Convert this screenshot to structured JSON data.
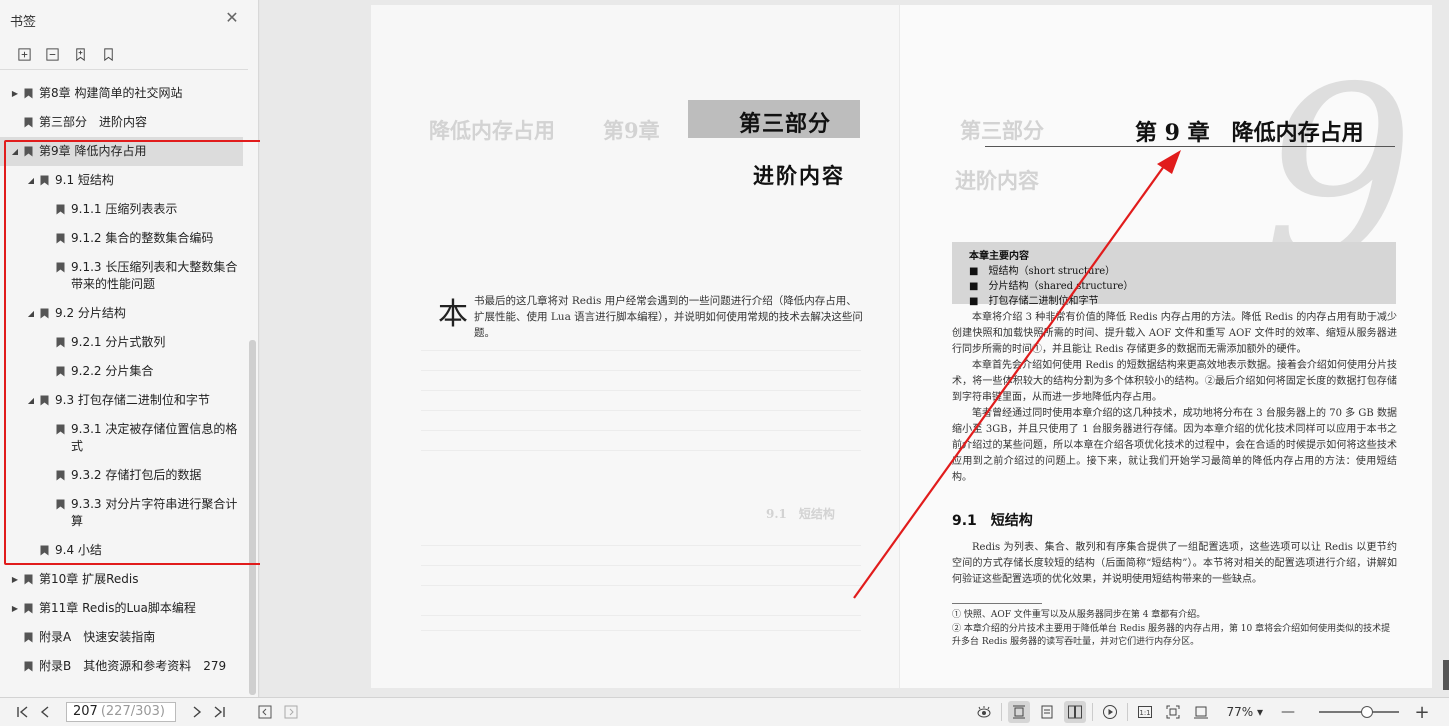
{
  "sidebar": {
    "title": "书签",
    "tools": [
      {
        "name": "expand-all-icon"
      },
      {
        "name": "collapse-all-icon"
      },
      {
        "name": "add-bookmark-icon"
      },
      {
        "name": "bookmark-icon"
      }
    ],
    "items": [
      {
        "label": "第8章 构建简单的社交网站",
        "level": 0,
        "arrow": "▶"
      },
      {
        "label": "第三部分　进阶内容",
        "level": 0,
        "arrow": ""
      },
      {
        "label": "第9章 降低内存占用",
        "level": 0,
        "arrow": "◢",
        "selected": true
      },
      {
        "label": "9.1 短结构",
        "level": 1,
        "arrow": "◢"
      },
      {
        "label": "9.1.1 压缩列表表示",
        "level": 2,
        "arrow": ""
      },
      {
        "label": "9.1.2 集合的整数集合编码",
        "level": 2,
        "arrow": ""
      },
      {
        "label": "9.1.3 长压缩列表和大整数集合带来的性能问题",
        "level": 2,
        "arrow": ""
      },
      {
        "label": "9.2 分片结构",
        "level": 1,
        "arrow": "◢"
      },
      {
        "label": "9.2.1 分片式散列",
        "level": 2,
        "arrow": ""
      },
      {
        "label": "9.2.2 分片集合",
        "level": 2,
        "arrow": ""
      },
      {
        "label": "9.3 打包存储二进制位和字节",
        "level": 1,
        "arrow": "◢"
      },
      {
        "label": "9.3.1 决定被存储位置信息的格式",
        "level": 2,
        "arrow": ""
      },
      {
        "label": "9.3.2 存储打包后的数据",
        "level": 2,
        "arrow": ""
      },
      {
        "label": "9.3.3 对分片字符串进行聚合计算",
        "level": 2,
        "arrow": ""
      },
      {
        "label": "9.4 小结",
        "level": 1,
        "arrow": ""
      },
      {
        "label": "第10章 扩展Redis",
        "level": 0,
        "arrow": "▶"
      },
      {
        "label": "第11章 Redis的Lua脚本编程",
        "level": 0,
        "arrow": "▶"
      },
      {
        "label": "附录A　快速安装指南",
        "level": 0,
        "arrow": ""
      },
      {
        "label": "附录B　其他资源和参考资料　279",
        "level": 0,
        "arrow": ""
      }
    ]
  },
  "left_page": {
    "part": "第三部分",
    "subtitle": "进阶内容",
    "ghost_left": "降低内存占用",
    "ghost_right": "第9章",
    "dropcap": "本",
    "intro": "书最后的这几章将对 Redis 用户经常会遇到的一些问题进行介绍（降低内存占用、扩展性能、使用 Lua 语言进行脚本编程），并说明如何使用常规的技术去解决这些问题。",
    "ghost_section": "9.1　短结构"
  },
  "right_page": {
    "chapter_title": "第 9 章　降低内存占用",
    "big_number": "9",
    "ghost_part": "第三部分",
    "ghost_sub": "进阶内容",
    "box_head": "本章主要内容",
    "box_items": [
      "■　短结构（short structure）",
      "■　分片结构（shared structure）",
      "■　打包存储二进制位和字节"
    ],
    "paragraphs": [
      "本章将介绍 3 种非常有价值的降低 Redis 内存占用的方法。降低 Redis 的内存占用有助于减少创建快照和加载快照所需的时间、提升载入 AOF 文件和重写 AOF 文件时的效率、缩短从服务器进行同步所需的时间①，并且能让 Redis 存储更多的数据而无需添加额外的硬件。",
      "本章首先会介绍如何使用 Redis 的短数据结构来更高效地表示数据。接着会介绍如何使用分片技术，将一些体积较大的结构分割为多个体积较小的结构。②最后介绍如何将固定长度的数据打包存储到字符串键里面，从而进一步地降低内存占用。",
      "笔者曾经通过同时使用本章介绍的这几种技术，成功地将分布在 3 台服务器上的 70 多 GB 数据缩小至 3GB，并且只使用了 1 台服务器进行存储。因为本章介绍的优化技术同样可以应用于本书之前介绍过的某些问题，所以本章在介绍各项优化技术的过程中，会在合适的时候提示如何将这些技术应用到之前介绍过的问题上。接下来，就让我们开始学习最简单的降低内存占用的方法：使用短结构。"
    ],
    "section_head": "9.1　短结构",
    "section_body": "Redis 为列表、集合、散列和有序集合提供了一组配置选项，这些选项可以让 Redis 以更节约空间的方式存储长度较短的结构（后面简称“短结构”）。本节将对相关的配置选项进行介绍，讲解如何验证这些配置选项的优化效果，并说明使用短结构带来的一些缺点。",
    "footnotes": [
      "①  快照、AOF 文件重写以及从服务器同步在第 4 章都有介绍。",
      "②  本章介绍的分片技术主要用于降低单台 Redis 服务器的内存占用，第 10 章将会介绍如何使用类似的技术提升多台 Redis 服务器的读写吞吐量，并对它们进行内存分区。"
    ]
  },
  "statusbar": {
    "page_current": "207",
    "page_total": "(227/303)",
    "zoom": "77%",
    "zoom_level": 0.6
  },
  "colors": {
    "highlight": "#e11c1c",
    "sidebar_bg": "#f5f5f5",
    "selected_bg": "#dcdcdc"
  }
}
